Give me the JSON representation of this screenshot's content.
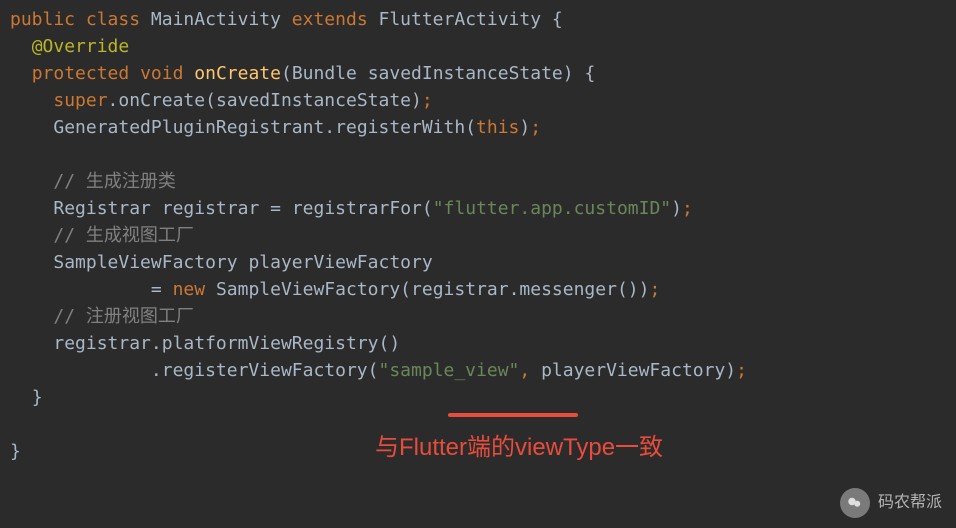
{
  "code": {
    "line1": {
      "kw_public": "public",
      "kw_class": "class",
      "classname": "MainActivity",
      "kw_extends": "extends",
      "superclass": "FlutterActivity",
      "brace": "{"
    },
    "line2": {
      "annotation": "@Override"
    },
    "line3": {
      "kw_protected": "protected",
      "kw_void": "void",
      "method": "onCreate",
      "paren_open": "(",
      "param_type": "Bundle",
      "param_name": "savedInstanceState",
      "paren_close": ")",
      "brace": "{"
    },
    "line4": {
      "kw_super": "super",
      "dot": ".",
      "method": "onCreate",
      "paren_open": "(",
      "arg": "savedInstanceState",
      "paren_close": ")",
      "semi": ";"
    },
    "line5": {
      "obj": "GeneratedPluginRegistrant",
      "dot": ".",
      "method": "registerWith",
      "paren_open": "(",
      "kw_this": "this",
      "paren_close": ")",
      "semi": ";"
    },
    "line7": {
      "comment": "// 生成注册类"
    },
    "line8": {
      "type": "Registrar",
      "varname": "registrar",
      "eq": "=",
      "method": "registrarFor",
      "paren_open": "(",
      "string": "\"flutter.app.customID\"",
      "paren_close": ")",
      "semi": ";"
    },
    "line9": {
      "comment": "// 生成视图工厂"
    },
    "line10": {
      "type": "SampleViewFactory",
      "varname": "playerViewFactory"
    },
    "line11": {
      "eq": "=",
      "kw_new": "new",
      "ctor": "SampleViewFactory",
      "paren_open": "(",
      "obj": "registrar",
      "dot": ".",
      "method": "messenger",
      "parens": "()",
      "paren_close": ")",
      "semi": ";"
    },
    "line12": {
      "comment": "// 注册视图工厂"
    },
    "line13": {
      "obj": "registrar",
      "dot": ".",
      "method": "platformViewRegistry",
      "parens": "()"
    },
    "line14": {
      "dot": ".",
      "method": "registerViewFactory",
      "paren_open": "(",
      "string": "\"sample_view\"",
      "comma": ",",
      "arg": "playerViewFactory",
      "paren_close": ")",
      "semi": ";"
    },
    "line15": {
      "brace": "}"
    },
    "line17": {
      "brace": "}"
    }
  },
  "annotation_text": "与Flutter端的viewType一致",
  "watermark": "码农帮派"
}
